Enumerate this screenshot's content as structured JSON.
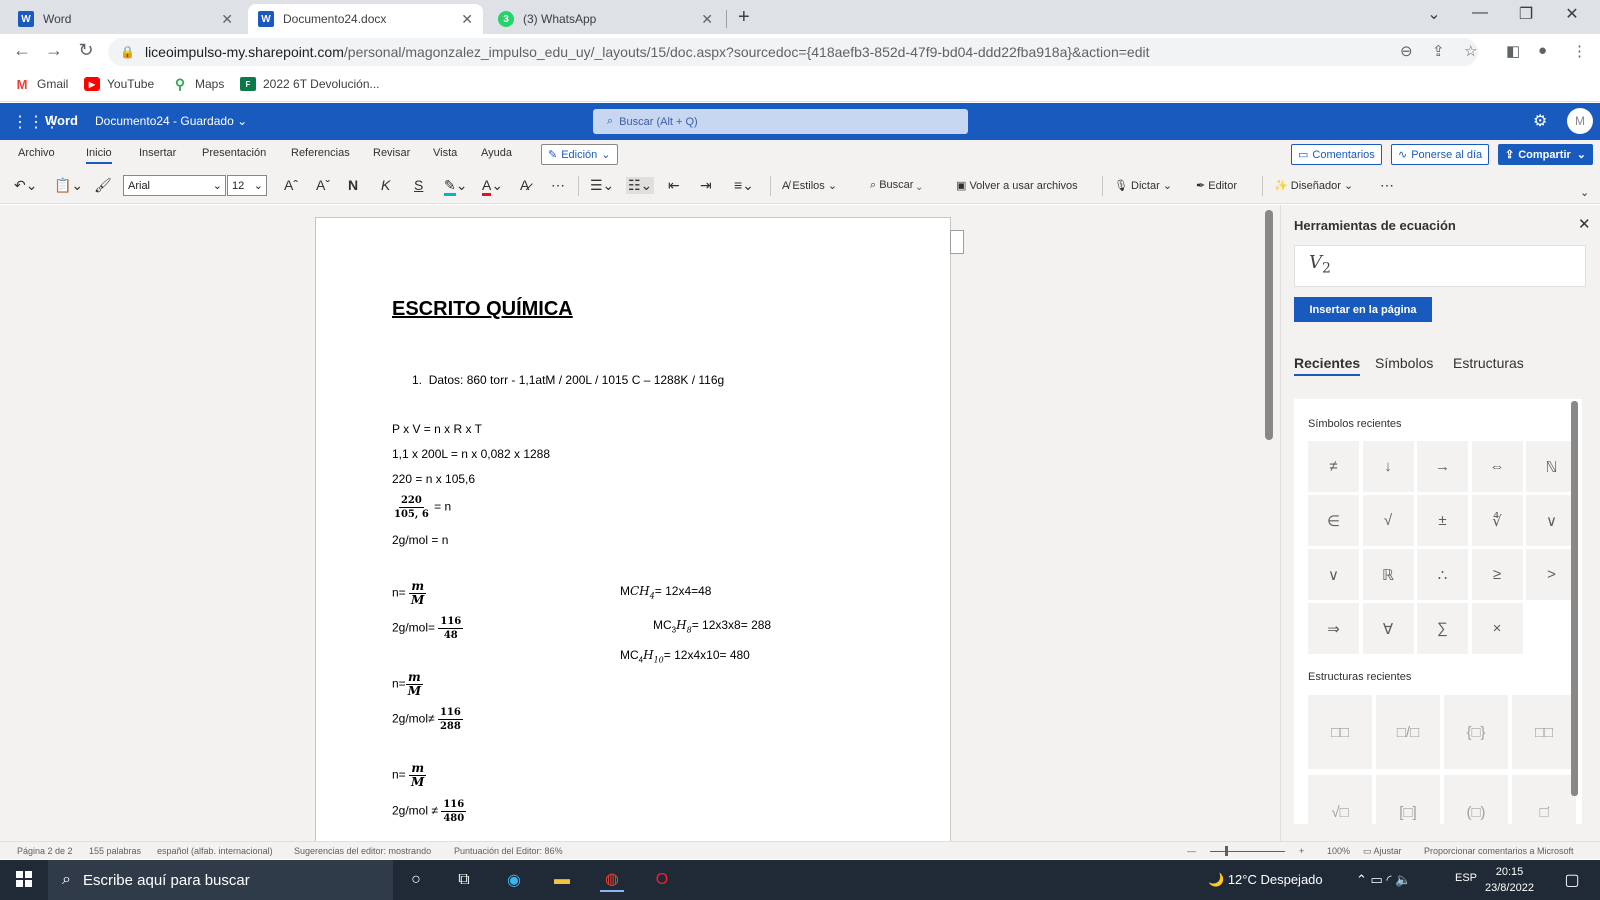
{
  "browser": {
    "tabs": [
      {
        "title": "Word",
        "icon": "W",
        "color": "#185abd"
      },
      {
        "title": "Documento24.docx",
        "icon": "W",
        "color": "#185abd"
      },
      {
        "title": "(3) WhatsApp",
        "icon": "3",
        "color": "#25d366"
      }
    ],
    "url_host": "liceoimpulso-my.sharepoint.com",
    "url_path": "/personal/magonzalez_impulso_edu_uy/_layouts/15/doc.aspx?sourcedoc={418aefb3-852d-47f9-bd04-ddd22fba918a}&action=edit",
    "bookmarks": [
      "Gmail",
      "YouTube",
      "Maps",
      "2022 6T Devolución..."
    ]
  },
  "word": {
    "app_name": "Word",
    "doc_name": "Documento24 - Guardado",
    "search_placeholder": "Buscar (Alt + Q)",
    "avatar": "M",
    "ribbon_tabs": [
      "Archivo",
      "Inicio",
      "Insertar",
      "Presentación",
      "Referencias",
      "Revisar",
      "Vista",
      "Ayuda"
    ],
    "edit_mode": "Edición",
    "comments": "Comentarios",
    "catch_up": "Ponerse al día",
    "share": "Compartir",
    "font_name": "Arial",
    "font_size": "12",
    "bold": "N",
    "italic": "K",
    "underline": "S",
    "styles": "Estilos",
    "find": "Buscar",
    "reuse": "Volver a usar archivos",
    "dictate": "Dictar",
    "editor": "Editor",
    "designer": "Diseñador"
  },
  "document": {
    "title": "ESCRITO QUÍMICA",
    "item1_num": "1.",
    "item1_text": "Datos:  860 torr - 1,1atM / 200L / 1015 C – 1288K / 116g",
    "eq1": "P x V = n x R x T",
    "eq2": "1,1 x 200L = n x 0,082 x 1288",
    "eq3": "220 = n x 105,6",
    "frac1_num": "220",
    "frac1_den": "105, 6",
    "frac1_rest": "= n",
    "eq5": "2g/mol = n",
    "n_eq": "n=",
    "m": "m",
    "M": "M",
    "gmol_eq": "2g/mol=",
    "gmol_neq": "2g/mol",
    "n116": "116",
    "d48": "48",
    "d288": "288",
    "d480": "480",
    "ch4_prefix": "M",
    "ch4_formula": "CH",
    "ch4_sub": "4",
    "ch4_rest": "= 12x4=48",
    "c3h8_prefix": "MC",
    "c3h8_sub1": "3",
    "c3h8_h": "H",
    "c3h8_sub2": "8",
    "c3h8_rest": "= 12x3x8= 288",
    "c4h10_prefix": "MC",
    "c4h10_sub1": "4",
    "c4h10_h": "H",
    "c4h10_sub2": "10",
    "c4h10_rest": "= 12x4x10= 480"
  },
  "equation_pane": {
    "title": "Herramientas de ecuación",
    "input_var": "V",
    "input_sub": "2",
    "insert_button": "Insertar en la página",
    "tabs": [
      "Recientes",
      "Símbolos",
      "Estructuras"
    ],
    "recent_symbols_label": "Símbolos recientes",
    "symbols": [
      "≠",
      "↓",
      "→",
      "⇔",
      "ℕ",
      "∈",
      "√",
      "±",
      "∜",
      "∨",
      "∨",
      "ℝ",
      "∴",
      "≥",
      ">",
      "⇒",
      "∀",
      "∑",
      "×"
    ],
    "recent_structures_label": "Estructuras recientes",
    "structures": [
      "□□",
      "□/□",
      "{□}",
      "□□",
      "√□",
      "[□]",
      "(□)",
      "□̇"
    ]
  },
  "status": {
    "page": "Página 2 de 2",
    "words": "155 palabras",
    "language": "español (alfab. internacional)",
    "suggestions": "Sugerencias del editor: mostrando",
    "score": "Puntuación del Editor: 86%",
    "zoom": "100%",
    "fit": "Ajustar",
    "feedback": "Proporcionar comentarios a Microsoft"
  },
  "taskbar": {
    "search_placeholder": "Escribe aquí para buscar",
    "weather": "12°C  Despejado",
    "lang": "ESP",
    "time": "20:15",
    "date": "23/8/2022"
  }
}
